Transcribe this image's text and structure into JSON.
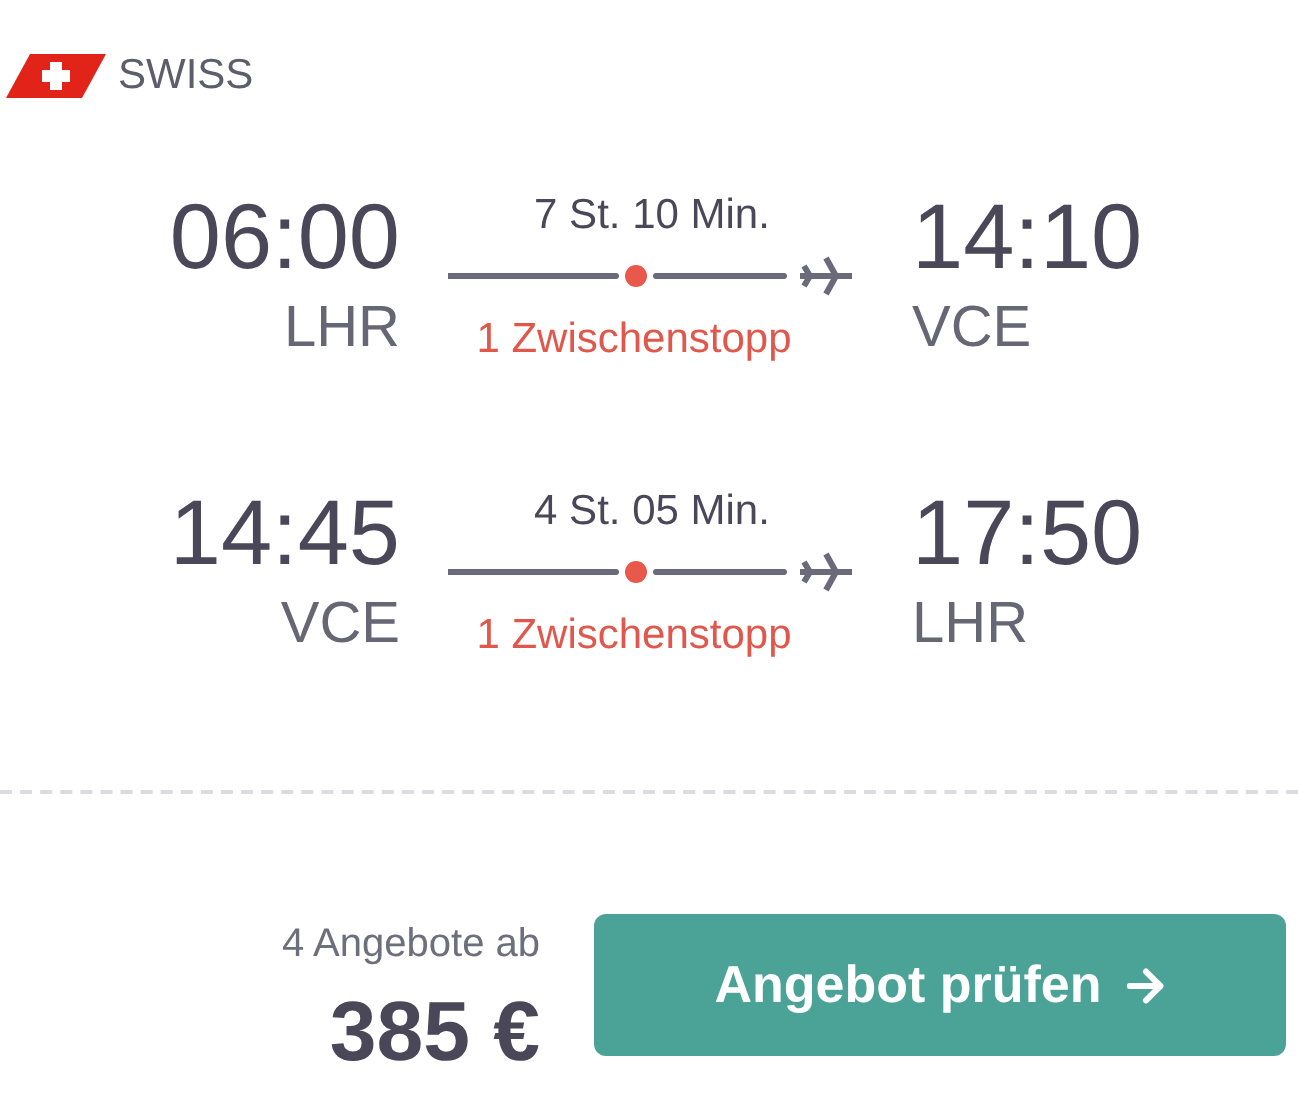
{
  "airline": {
    "name": "SWISS"
  },
  "legs": [
    {
      "departure_time": "06:00",
      "departure_airport": "LHR",
      "duration": "7 St. 10 Min.",
      "stops": "1 Zwischenstopp",
      "arrival_time": "14:10",
      "arrival_airport": "VCE"
    },
    {
      "departure_time": "14:45",
      "departure_airport": "VCE",
      "duration": "4 St. 05 Min.",
      "stops": "1 Zwischenstopp",
      "arrival_time": "17:50",
      "arrival_airport": "LHR"
    }
  ],
  "offers": {
    "label": "4 Angebote ab",
    "price": "385 €"
  },
  "button": {
    "label": "Angebot prüfen"
  }
}
